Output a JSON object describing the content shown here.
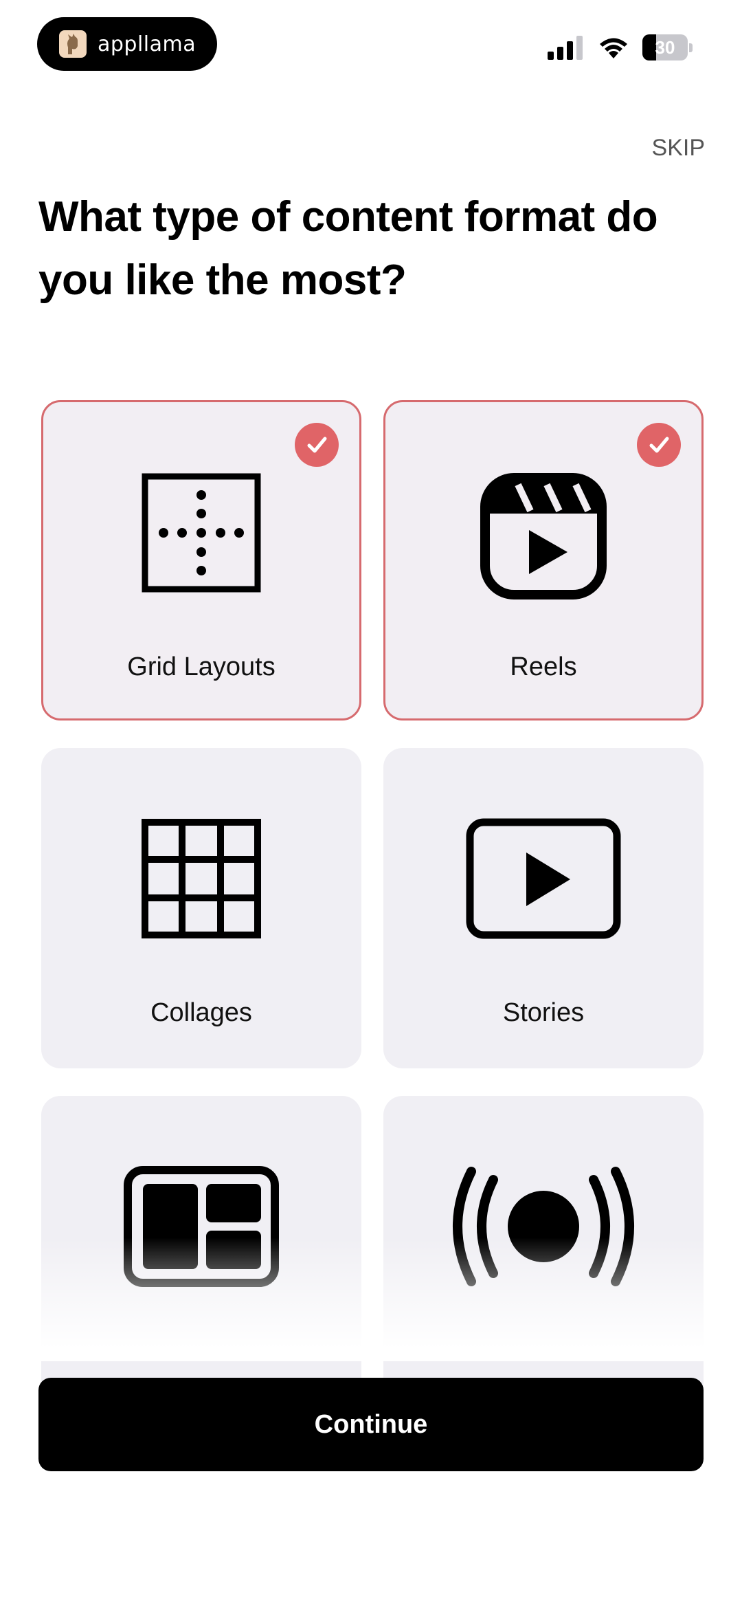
{
  "status_bar": {
    "app_name": "appllama",
    "battery": "30",
    "battery_level_percent": 30
  },
  "skip_label": "SKIP",
  "title": "What type of content format do you like the most?",
  "options": [
    {
      "label": "Grid Layouts",
      "icon": "grid-layout-icon",
      "selected": true
    },
    {
      "label": "Reels",
      "icon": "reels-icon",
      "selected": true
    },
    {
      "label": "Collages",
      "icon": "collage-icon",
      "selected": false
    },
    {
      "label": "Stories",
      "icon": "stories-play-icon",
      "selected": false
    },
    {
      "label": "",
      "icon": "carousel-layout-icon",
      "selected": false
    },
    {
      "label": "",
      "icon": "live-broadcast-icon",
      "selected": false
    }
  ],
  "continue_label": "Continue",
  "colors": {
    "accent": "#e06467",
    "card_bg": "#f0eff4",
    "selected_border": "#d66a6e",
    "button": "#000000"
  }
}
